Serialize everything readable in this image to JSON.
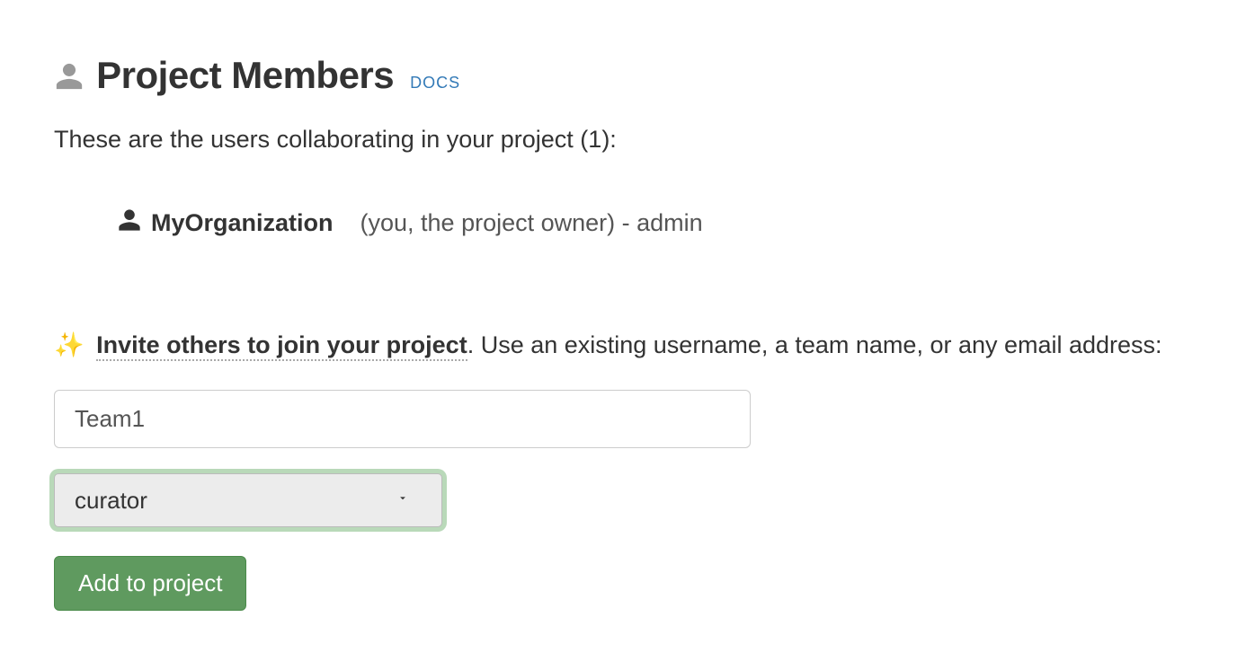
{
  "header": {
    "title": "Project Members",
    "docs_label": "DOCS"
  },
  "subtitle": "These are the users collaborating in your project (1):",
  "members": [
    {
      "name": "MyOrganization",
      "note": "(you, the project owner) - admin"
    }
  ],
  "invite": {
    "sparkles": "✨",
    "phrase": "Invite others to join your project",
    "suffix": ". Use an existing username, a team name, or any email address:",
    "input_value": "Team1",
    "role_selected": "curator",
    "add_button_label": "Add to project"
  }
}
